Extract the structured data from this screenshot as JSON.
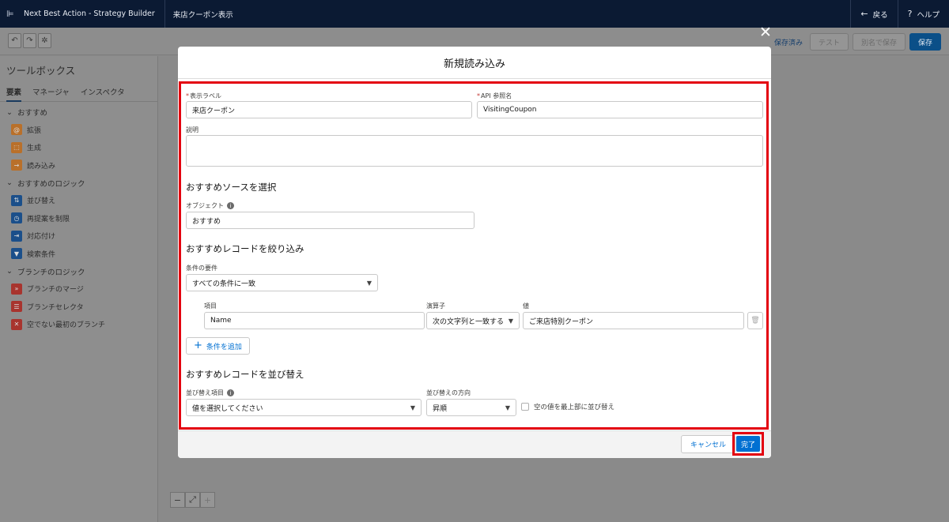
{
  "appbar": {
    "app_title": "Next Best Action - Strategy Builder",
    "page_name": "来店クーポン表示",
    "back_label": "戻る",
    "help_label": "ヘルプ"
  },
  "toolbar": {
    "saved_label": "保存済み",
    "test_label": "テスト",
    "save_as_label": "別名で保存",
    "save_label": "保存"
  },
  "toolbox": {
    "title": "ツールボックス",
    "tabs": [
      "要素",
      "マネージャ",
      "インスペクタ"
    ],
    "sections": [
      {
        "label": "おすすめ",
        "items": [
          {
            "label": "拡張",
            "color": "#b9702a",
            "icon": "@"
          },
          {
            "label": "生成",
            "color": "#b9702a",
            "icon": "⬚"
          },
          {
            "label": "読み込み",
            "color": "#b9702a",
            "icon": "→"
          }
        ]
      },
      {
        "label": "おすすめのロジック",
        "items": [
          {
            "label": "並び替え",
            "color": "#1b4f8a",
            "icon": "⇅"
          },
          {
            "label": "再提案を制限",
            "color": "#1b4f8a",
            "icon": "◷"
          },
          {
            "label": "対応付け",
            "color": "#1b4f8a",
            "icon": "⇥"
          },
          {
            "label": "検索条件",
            "color": "#1b4f8a",
            "icon": "▼"
          }
        ]
      },
      {
        "label": "ブランチのロジック",
        "items": [
          {
            "label": "ブランチのマージ",
            "color": "#a8342e",
            "icon": "»"
          },
          {
            "label": "ブランチセレクタ",
            "color": "#a8342e",
            "icon": "☰"
          },
          {
            "label": "空でない最初のブランチ",
            "color": "#a8342e",
            "icon": "✕"
          }
        ]
      }
    ]
  },
  "modal": {
    "title": "新規読み込み",
    "display_label": {
      "label": "表示ラベル",
      "value": "来店クーポン"
    },
    "api_name": {
      "label": "API 参照名",
      "value": "VisitingCoupon"
    },
    "description": {
      "label": "説明",
      "value": ""
    },
    "source_section": "おすすめソースを選択",
    "object": {
      "label": "オブジェクト",
      "value": "おすすめ"
    },
    "filter_section": "おすすめレコードを絞り込み",
    "requirement": {
      "label": "条件の要件",
      "value": "すべての条件に一致"
    },
    "condition": {
      "field_label": "項目",
      "field_value": "Name",
      "operator_label": "演算子",
      "operator_value": "次の文字列と一致する",
      "value_label": "値",
      "value_value": "ご来店特別クーポン"
    },
    "add_condition": "条件を追加",
    "sort_section": "おすすめレコードを並び替え",
    "sort_field": {
      "label": "並び替え項目",
      "placeholder": "値を選択してください"
    },
    "sort_direction": {
      "label": "並び替えの方向",
      "value": "昇順"
    },
    "nulls_first": "空の値を最上部に並び替え",
    "cancel_label": "キャンセル",
    "done_label": "完了"
  },
  "colors": {
    "highlight": "#e3000f",
    "brand": "#0070d2",
    "appbar": "#0b1a33"
  }
}
